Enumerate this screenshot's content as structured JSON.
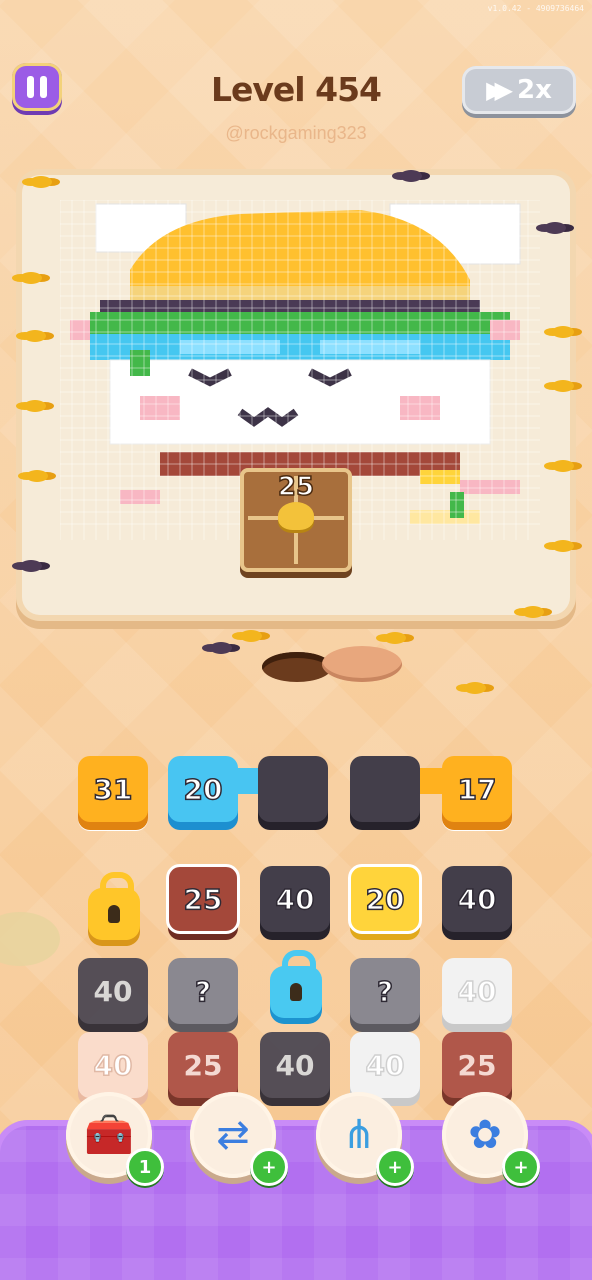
{
  "version": "v1.0.42 - 4909736464",
  "header": {
    "level_label": "Level 454",
    "watermark": "@rockgaming323",
    "speed_label": "2x"
  },
  "board": {
    "crate_count": "25"
  },
  "conveyor": [
    {
      "value": "31",
      "color": "orange"
    },
    {
      "value": "20",
      "color": "blue"
    },
    {
      "value": "",
      "color": "dark"
    },
    {
      "value": "",
      "color": "dark"
    },
    {
      "value": "17",
      "color": "orange"
    }
  ],
  "grid": {
    "row1": [
      {
        "type": "lock",
        "color": "gold"
      },
      {
        "value": "25",
        "color": "brown"
      },
      {
        "value": "40",
        "color": "dark"
      },
      {
        "value": "20",
        "color": "yellow"
      },
      {
        "value": "40",
        "color": "dark"
      }
    ],
    "row2": [
      {
        "value": "40",
        "color": "dim-dark"
      },
      {
        "value": "?",
        "color": "mystery"
      },
      {
        "type": "lock",
        "color": "cyan"
      },
      {
        "value": "?",
        "color": "mystery"
      },
      {
        "value": "40",
        "color": "ghost-white"
      }
    ],
    "row3": [
      {
        "value": "40",
        "color": "ghost-peach"
      },
      {
        "value": "25",
        "color": "dim-brown"
      },
      {
        "value": "40",
        "color": "dim-dark"
      },
      {
        "value": "40",
        "color": "ghost-white"
      },
      {
        "value": "25",
        "color": "dim-brown"
      }
    ]
  },
  "boosters": [
    {
      "name": "add-slot",
      "badge": "1",
      "icon": "crate-plus-icon"
    },
    {
      "name": "shuffle",
      "badge": "+",
      "icon": "shuffle-arrows-icon"
    },
    {
      "name": "magnet",
      "badge": "+",
      "icon": "magnet-claw-icon"
    },
    {
      "name": "flower",
      "badge": "+",
      "icon": "flower-icon"
    }
  ],
  "colors": {
    "accent": "#9b5ce6",
    "tray": "#b26ff0",
    "badge": "#3fbf3c"
  }
}
